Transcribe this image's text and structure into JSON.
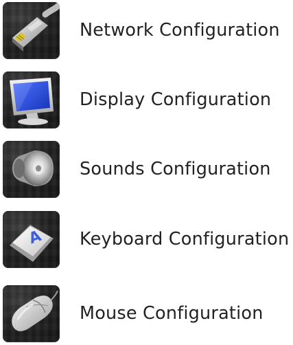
{
  "menu": {
    "items": [
      {
        "label": "Network Configuration",
        "icon": "network-cable-icon"
      },
      {
        "label": "Display Configuration",
        "icon": "monitor-icon"
      },
      {
        "label": "Sounds Configuration",
        "icon": "speaker-icon"
      },
      {
        "label": "Keyboard Configuration",
        "icon": "keyboard-key-icon"
      },
      {
        "label": "Mouse Configuration",
        "icon": "mouse-icon"
      }
    ]
  },
  "colors": {
    "text": "#222222",
    "tile_background": "#1c1c1c",
    "monitor_screen": "#1f46e0"
  }
}
